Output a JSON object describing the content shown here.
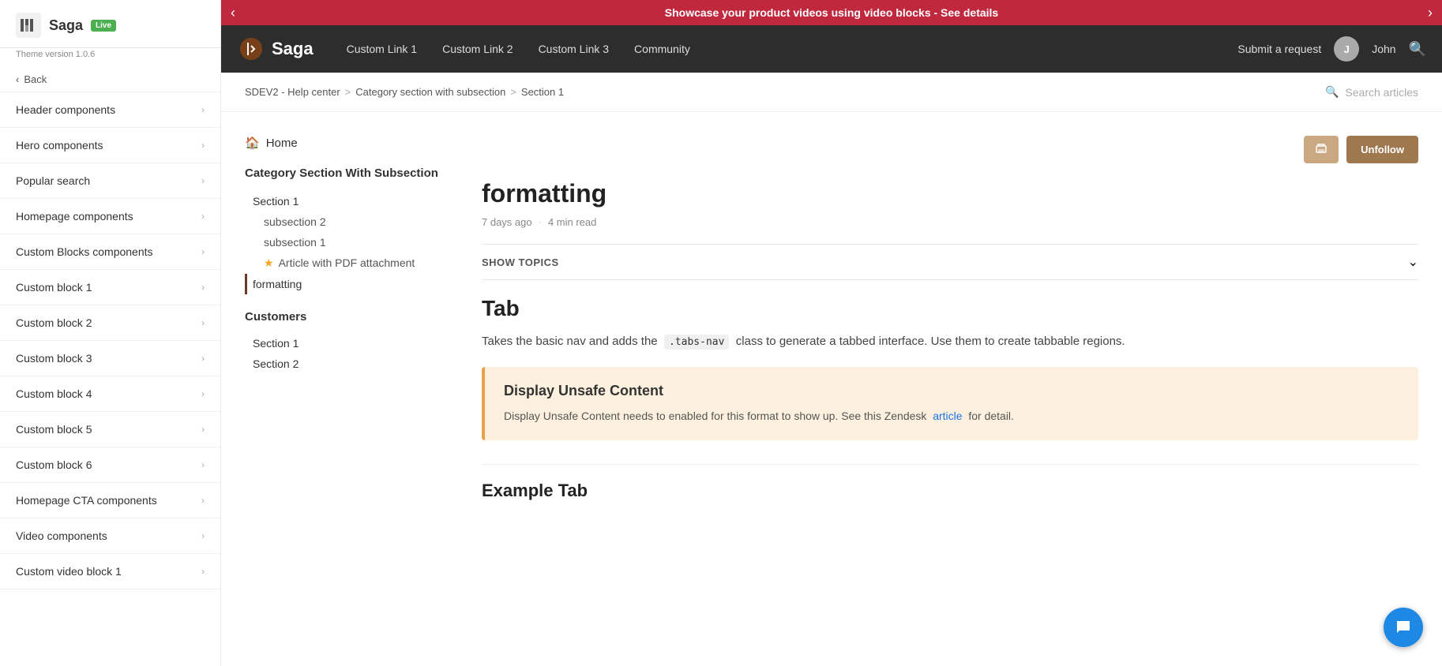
{
  "sidebar": {
    "logo_text": "Saga",
    "badge": "Live",
    "version": "Theme version 1.0.6",
    "back_label": "Back",
    "items": [
      {
        "label": "Header components",
        "id": "header-components"
      },
      {
        "label": "Hero components",
        "id": "hero-components"
      },
      {
        "label": "Popular search",
        "id": "popular-search"
      },
      {
        "label": "Homepage components",
        "id": "homepage-components"
      },
      {
        "label": "Custom Blocks components",
        "id": "custom-blocks-components"
      },
      {
        "label": "Custom block 1",
        "id": "custom-block-1"
      },
      {
        "label": "Custom block 2",
        "id": "custom-block-2"
      },
      {
        "label": "Custom block 3",
        "id": "custom-block-3"
      },
      {
        "label": "Custom block 4",
        "id": "custom-block-4"
      },
      {
        "label": "Custom block 5",
        "id": "custom-block-5"
      },
      {
        "label": "Custom block 6",
        "id": "custom-block-6"
      },
      {
        "label": "Homepage CTA components",
        "id": "homepage-cta-components"
      },
      {
        "label": "Video components",
        "id": "video-components"
      },
      {
        "label": "Custom video block 1",
        "id": "custom-video-block-1"
      }
    ]
  },
  "announcement": {
    "text": "Showcase your product videos using video blocks - See details"
  },
  "navbar": {
    "logo_text": "Saga",
    "links": [
      {
        "label": "Custom Link 1"
      },
      {
        "label": "Custom Link 2"
      },
      {
        "label": "Custom Link 3"
      },
      {
        "label": "Community"
      }
    ],
    "submit_request": "Submit a request",
    "user_name": "John"
  },
  "breadcrumb": {
    "items": [
      {
        "label": "SDEV2 - Help center"
      },
      {
        "label": "Category section with subsection"
      },
      {
        "label": "Section 1"
      }
    ],
    "search_placeholder": "Search articles"
  },
  "content_nav": {
    "home_label": "Home",
    "section_title": "Category Section With Subsection",
    "nav_items": [
      {
        "label": "Section 1",
        "type": "item"
      },
      {
        "label": "subsection 2",
        "type": "subitem"
      },
      {
        "label": "subsection 1",
        "type": "subitem"
      },
      {
        "label": "Article with PDF attachment",
        "type": "starred"
      },
      {
        "label": "formatting",
        "type": "active"
      }
    ],
    "customers_title": "Customers",
    "customers_items": [
      {
        "label": "Section 1"
      },
      {
        "label": "Section 2"
      }
    ]
  },
  "article": {
    "title": "formatting",
    "meta_time": "7 days ago",
    "meta_read": "4 min read",
    "btn_print_label": "🖨",
    "btn_unfollow_label": "Unfollow",
    "show_topics_label": "SHOW TOPICS",
    "tab_title": "Tab",
    "tab_description_1": "Takes the basic nav and adds the",
    "tab_code": ".tabs-nav",
    "tab_description_2": "class to generate a tabbed interface. Use them to create tabbable regions.",
    "unsafe_title": "Display Unsafe Content",
    "unsafe_text_1": "Display Unsafe Content needs to enabled for this format to show up. See this Zendesk",
    "unsafe_link": "article",
    "unsafe_text_2": "for detail.",
    "example_tab_label": "Example Tab"
  },
  "colors": {
    "announcement_bg": "#c0283e",
    "navbar_bg": "#2d2d2d",
    "accent": "#6b3a2a",
    "unsafe_bg": "#fdf0de",
    "unsafe_border": "#e8a04a",
    "chat_bg": "#1e88e5"
  }
}
